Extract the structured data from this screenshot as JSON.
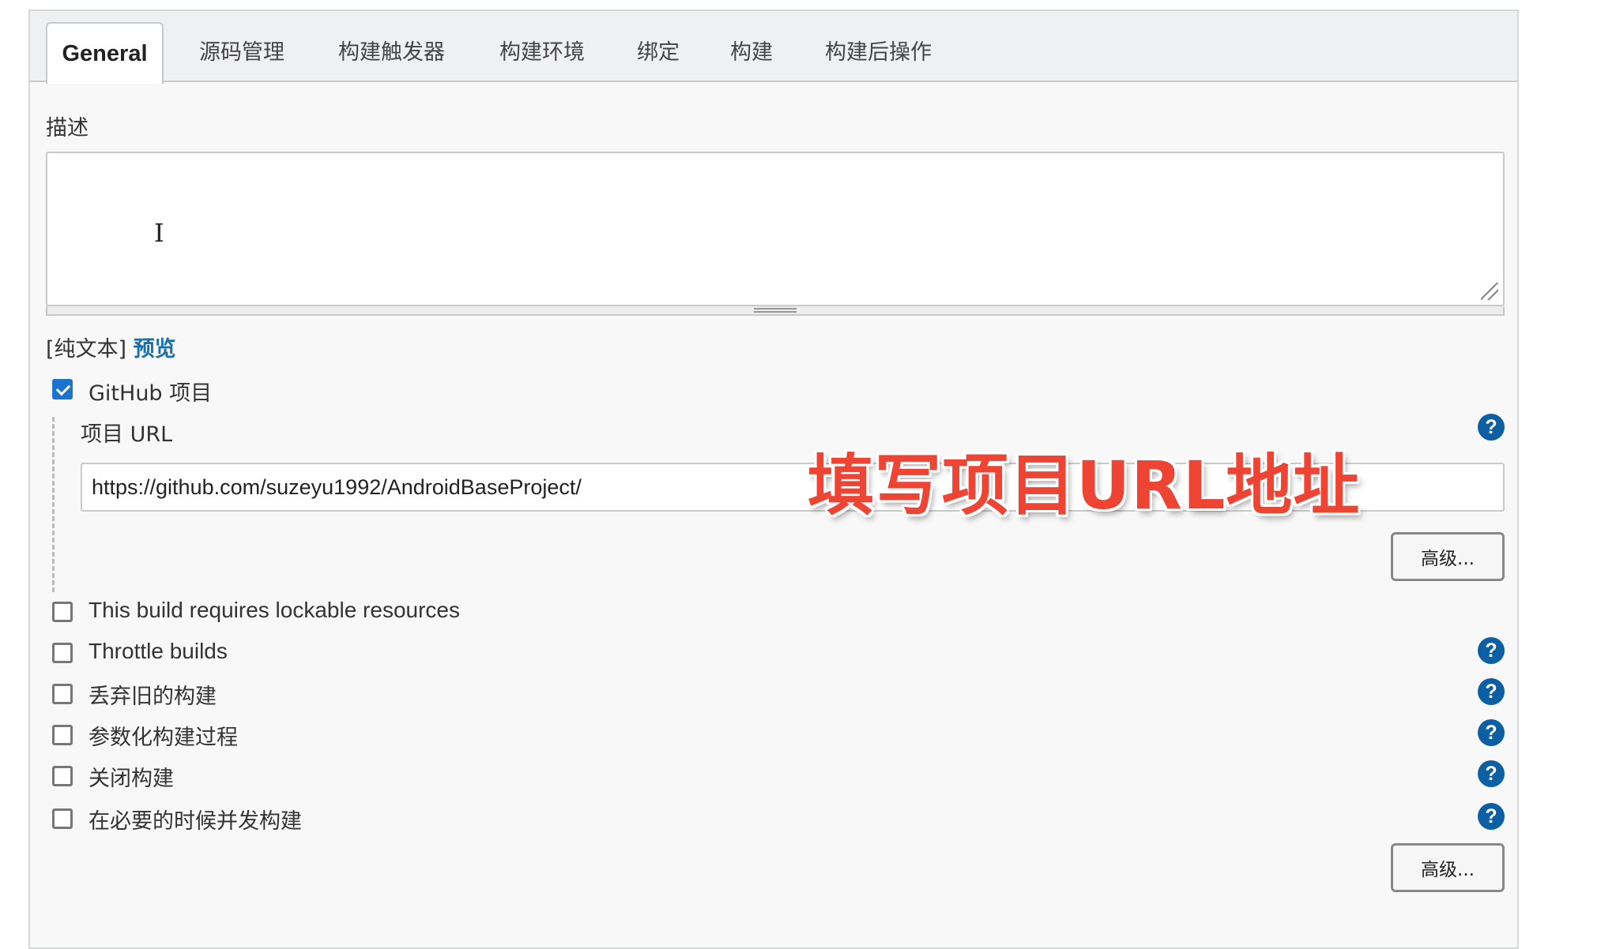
{
  "tabs": [
    {
      "label": "General",
      "active": true
    },
    {
      "label": "源码管理"
    },
    {
      "label": "构建触发器"
    },
    {
      "label": "构建环境"
    },
    {
      "label": "绑定"
    },
    {
      "label": "构建"
    },
    {
      "label": "构建后操作"
    }
  ],
  "description": {
    "label": "描述",
    "value": "",
    "format_prefix": "[纯文本]",
    "preview_link": "预览"
  },
  "github_project": {
    "checkbox_label": "GitHub 项目",
    "checked": true,
    "url_label": "项目 URL",
    "url_value": "https://github.com/suzeyu1992/AndroidBaseProject/",
    "advanced_button": "高级..."
  },
  "options": [
    {
      "label": "This build requires lockable resources",
      "checked": false,
      "help": false
    },
    {
      "label": "Throttle builds",
      "checked": false,
      "help": true
    },
    {
      "label": "丢弃旧的构建",
      "checked": false,
      "help": true
    },
    {
      "label": "参数化构建过程",
      "checked": false,
      "help": true
    },
    {
      "label": "关闭构建",
      "checked": false,
      "help": true
    },
    {
      "label": "在必要的时候并发构建",
      "checked": false,
      "help": true
    }
  ],
  "advanced_button_bottom": "高级...",
  "annotation": "填写项目URL地址",
  "help_icon_glyph": "?",
  "colors": {
    "accent": "#1b73d0",
    "help": "#0d5fa3",
    "link": "#1b6fa8",
    "annotation": "#ee4434"
  }
}
